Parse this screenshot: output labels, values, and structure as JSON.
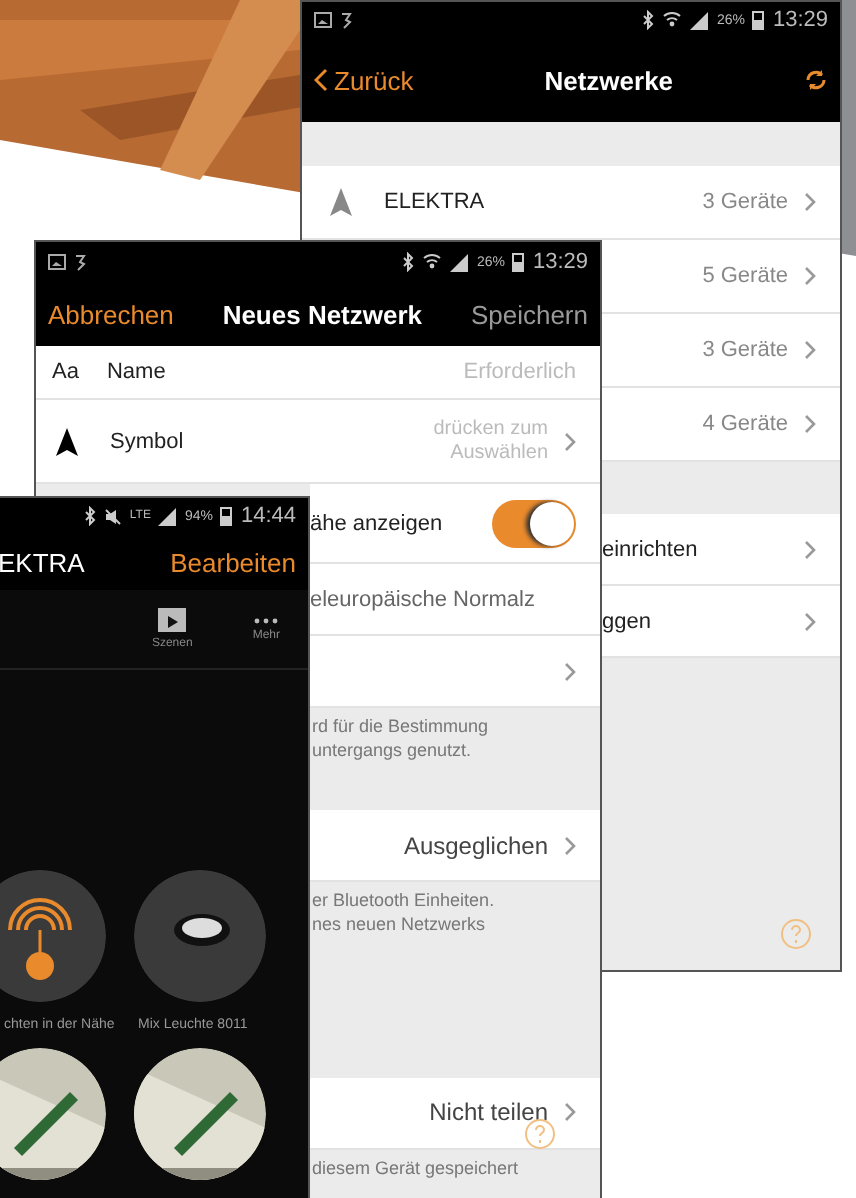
{
  "network_list_screen": {
    "status_bar": {
      "battery": "26%",
      "time": "13:29"
    },
    "nav": {
      "back": "Zurück",
      "title": "Netzwerke"
    },
    "networks": [
      {
        "name": "ELEKTRA",
        "count": "3 Geräte"
      },
      {
        "count": "5 Geräte"
      },
      {
        "count": "3 Geräte"
      },
      {
        "count": "4 Geräte"
      }
    ],
    "actions": [
      {
        "label": "einrichten"
      },
      {
        "label": "ggen"
      }
    ]
  },
  "new_network_screen": {
    "status_bar": {
      "battery": "26%",
      "time": "13:29"
    },
    "nav": {
      "cancel": "Abbrechen",
      "title": "Neues Netzwerk",
      "save": "Speichern"
    },
    "rows": [
      {
        "kind": "field",
        "icon_text": "Aa",
        "label": "Name",
        "placeholder": "Erforderlich"
      },
      {
        "kind": "picker",
        "label": "Symbol",
        "placeholder": "drücken zum Auswählen"
      },
      {
        "kind": "toggle",
        "label": "ähe anzeigen",
        "on": true
      },
      {
        "kind": "text",
        "label": "eleuropäische Normalz"
      },
      {
        "kind": "link"
      },
      {
        "kind": "note",
        "lines": [
          "rd für die Bestimmung",
          "untergangs genutzt."
        ]
      },
      {
        "kind": "gap"
      },
      {
        "kind": "link",
        "value": "Ausgeglichen"
      },
      {
        "kind": "note",
        "lines": [
          "er Bluetooth Einheiten.",
          "nes neuen Netzwerks"
        ]
      },
      {
        "kind": "gap"
      },
      {
        "kind": "link",
        "value": "Nicht teilen"
      },
      {
        "kind": "note",
        "lines": [
          "diesem Gerät gespeichert"
        ]
      }
    ]
  },
  "network_screen": {
    "status_bar": {
      "network": "LTE",
      "battery": "94%",
      "time": "14:44"
    },
    "nav": {
      "title": "EKTRA",
      "edit": "Bearbeiten"
    },
    "tabs": [
      {
        "kind": "scenes",
        "label": "Szenen"
      },
      {
        "kind": "more",
        "label": "Mehr"
      }
    ],
    "tiles": [
      {
        "kind": "nearby",
        "label": "chten in der Nähe"
      },
      {
        "kind": "lamp",
        "label": "Mix Leuchte 8011"
      },
      {
        "kind": "picture"
      },
      {
        "kind": "picture"
      }
    ]
  }
}
